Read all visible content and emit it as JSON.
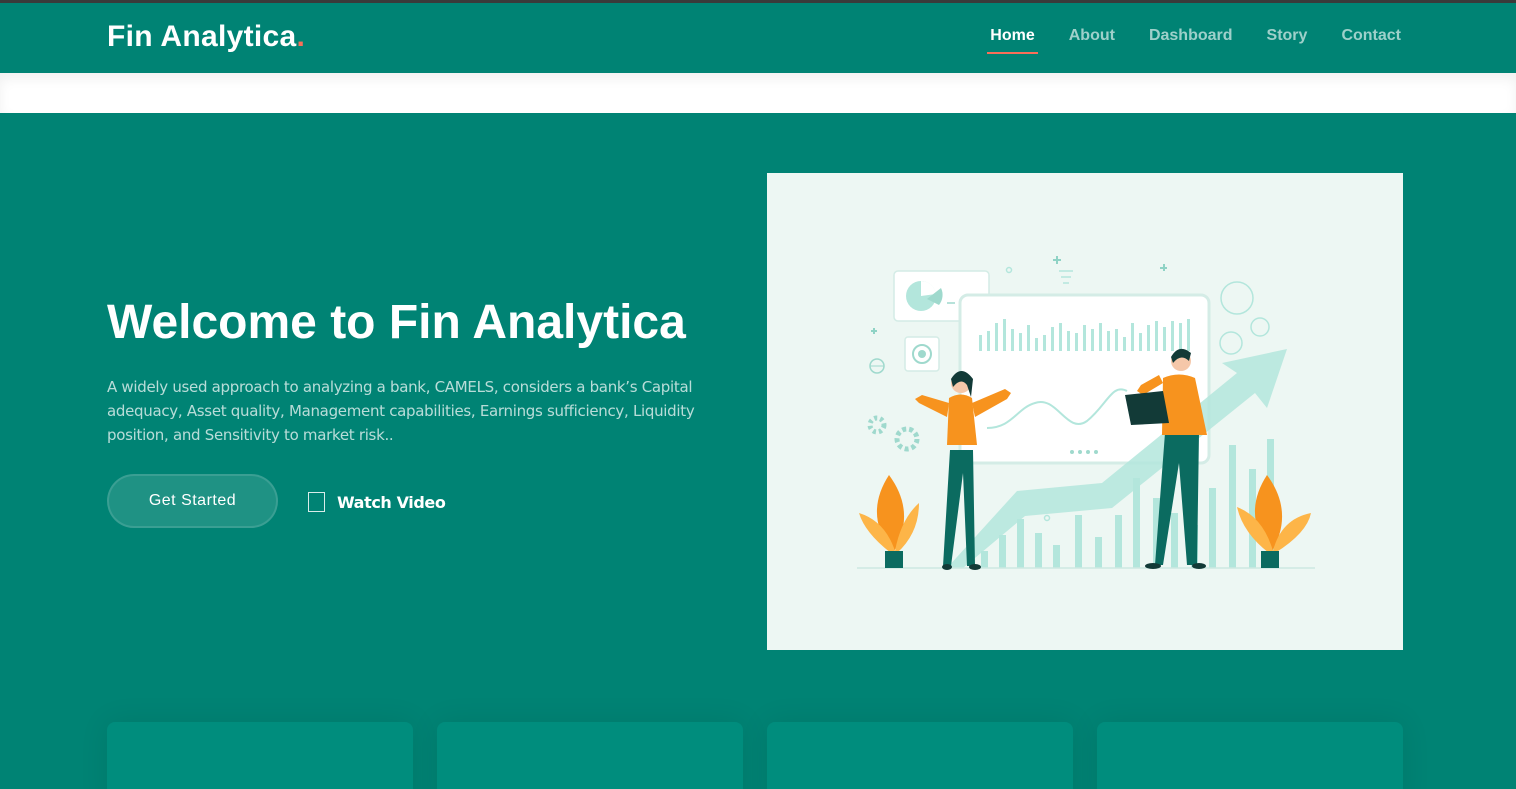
{
  "brand": {
    "name": "Fin Analytica",
    "dot": "."
  },
  "nav": {
    "items": [
      {
        "label": "Home",
        "active": true
      },
      {
        "label": "About",
        "active": false
      },
      {
        "label": "Dashboard",
        "active": false
      },
      {
        "label": "Story",
        "active": false
      },
      {
        "label": "Contact",
        "active": false
      }
    ]
  },
  "hero": {
    "title": "Welcome to Fin Analytica",
    "text": "A widely used approach to analyzing a bank, CAMELS, considers a bank’s Capital adequacy, Asset quality, Management capabilities, Earnings sufficiency, Liquidity position, and Sensitivity to market risk..",
    "cta_label": "Get Started",
    "watch_label": "Watch Video"
  },
  "colors": {
    "primary": "#008374",
    "accent": "#f96f59",
    "illustration_bg": "#edf7f3",
    "orange": "#f7931e",
    "teal_dark": "#0b6b60",
    "mint": "#b3e6dc"
  },
  "icons": {
    "watch": "square-outline-icon",
    "illustration": "analytics-people-illustration"
  }
}
